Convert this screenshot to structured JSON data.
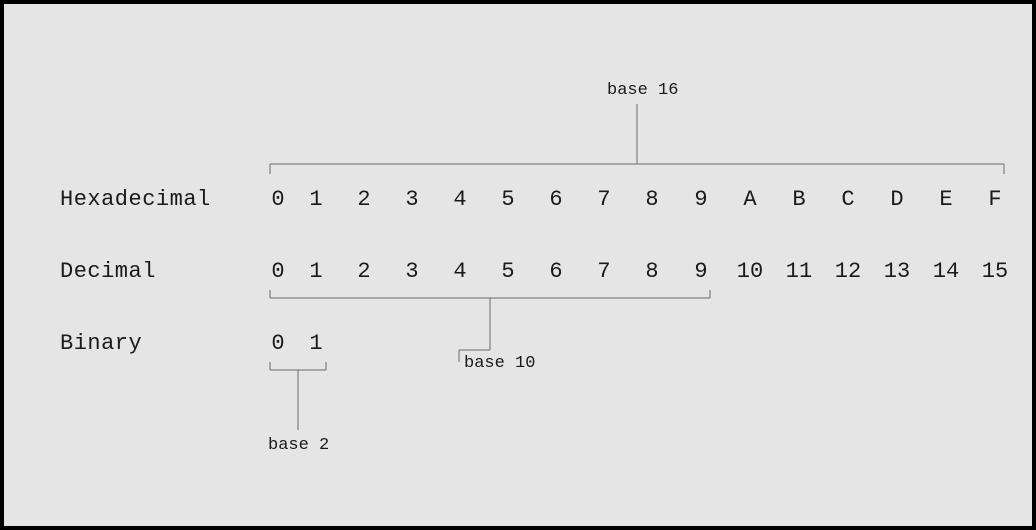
{
  "rows": {
    "hex": {
      "label": "Hexadecimal",
      "digits": [
        "0",
        "1",
        "2",
        "3",
        "4",
        "5",
        "6",
        "7",
        "8",
        "9",
        "A",
        "B",
        "C",
        "D",
        "E",
        "F"
      ]
    },
    "dec": {
      "label": "Decimal",
      "digits": [
        "0",
        "1",
        "2",
        "3",
        "4",
        "5",
        "6",
        "7",
        "8",
        "9",
        "10",
        "11",
        "12",
        "13",
        "14",
        "15"
      ]
    },
    "bin": {
      "label": "Binary",
      "digits": [
        "0",
        "1"
      ]
    }
  },
  "annotations": {
    "base16": "base 16",
    "base10": "base 10",
    "base2": "base 2"
  },
  "chart_data": {
    "type": "table",
    "title": "Number base digit sets",
    "series": [
      {
        "name": "Hexadecimal",
        "base": 16,
        "digits": [
          "0",
          "1",
          "2",
          "3",
          "4",
          "5",
          "6",
          "7",
          "8",
          "9",
          "A",
          "B",
          "C",
          "D",
          "E",
          "F"
        ]
      },
      {
        "name": "Decimal",
        "base": 10,
        "digits": [
          "0",
          "1",
          "2",
          "3",
          "4",
          "5",
          "6",
          "7",
          "8",
          "9",
          "10",
          "11",
          "12",
          "13",
          "14",
          "15"
        ]
      },
      {
        "name": "Binary",
        "base": 2,
        "digits": [
          "0",
          "1"
        ]
      }
    ],
    "annotations": [
      "base 16",
      "base 10",
      "base 2"
    ]
  }
}
